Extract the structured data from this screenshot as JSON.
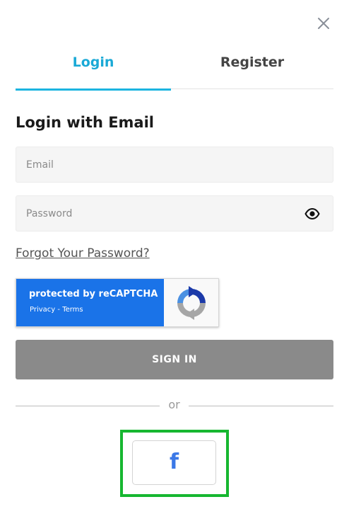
{
  "icons": {
    "close": "close-icon",
    "eye": "eye-icon",
    "recaptcha": "recaptcha-logo-icon",
    "facebook": "facebook-icon"
  },
  "tabs": [
    {
      "label": "Login",
      "active": true
    },
    {
      "label": "Register",
      "active": false
    }
  ],
  "heading": "Login with Email",
  "email": {
    "placeholder": "Email",
    "value": ""
  },
  "password": {
    "placeholder": "Password",
    "value": ""
  },
  "forgot_password": "Forgot Your Password?",
  "recaptcha": {
    "title": "protected by reCAPTCHA",
    "privacy": "Privacy",
    "separator": " - ",
    "terms": "Terms"
  },
  "signin_label": "SIGN IN",
  "divider_text": "or",
  "social": {
    "facebook_glyph": "f"
  },
  "colors": {
    "accent": "#1cb4e0",
    "signin_bg": "#8a8a8a",
    "recaptcha_blue": "#1a73e8",
    "highlight": "#16b730",
    "facebook": "#3b78e7"
  }
}
